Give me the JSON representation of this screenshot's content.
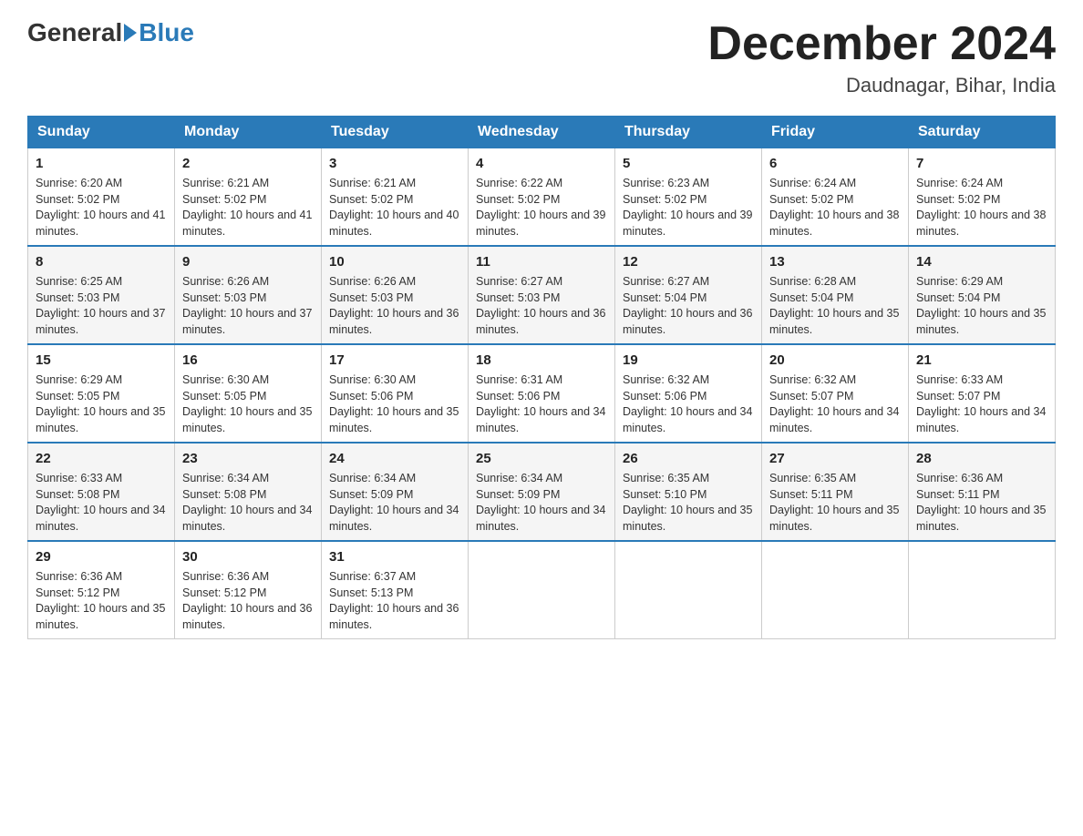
{
  "header": {
    "logo_general": "General",
    "logo_blue": "Blue",
    "title": "December 2024",
    "location": "Daudnagar, Bihar, India"
  },
  "weekdays": [
    "Sunday",
    "Monday",
    "Tuesday",
    "Wednesday",
    "Thursday",
    "Friday",
    "Saturday"
  ],
  "weeks": [
    [
      {
        "day": 1,
        "sunrise": "6:20 AM",
        "sunset": "5:02 PM",
        "daylight": "10 hours and 41 minutes."
      },
      {
        "day": 2,
        "sunrise": "6:21 AM",
        "sunset": "5:02 PM",
        "daylight": "10 hours and 41 minutes."
      },
      {
        "day": 3,
        "sunrise": "6:21 AM",
        "sunset": "5:02 PM",
        "daylight": "10 hours and 40 minutes."
      },
      {
        "day": 4,
        "sunrise": "6:22 AM",
        "sunset": "5:02 PM",
        "daylight": "10 hours and 39 minutes."
      },
      {
        "day": 5,
        "sunrise": "6:23 AM",
        "sunset": "5:02 PM",
        "daylight": "10 hours and 39 minutes."
      },
      {
        "day": 6,
        "sunrise": "6:24 AM",
        "sunset": "5:02 PM",
        "daylight": "10 hours and 38 minutes."
      },
      {
        "day": 7,
        "sunrise": "6:24 AM",
        "sunset": "5:02 PM",
        "daylight": "10 hours and 38 minutes."
      }
    ],
    [
      {
        "day": 8,
        "sunrise": "6:25 AM",
        "sunset": "5:03 PM",
        "daylight": "10 hours and 37 minutes."
      },
      {
        "day": 9,
        "sunrise": "6:26 AM",
        "sunset": "5:03 PM",
        "daylight": "10 hours and 37 minutes."
      },
      {
        "day": 10,
        "sunrise": "6:26 AM",
        "sunset": "5:03 PM",
        "daylight": "10 hours and 36 minutes."
      },
      {
        "day": 11,
        "sunrise": "6:27 AM",
        "sunset": "5:03 PM",
        "daylight": "10 hours and 36 minutes."
      },
      {
        "day": 12,
        "sunrise": "6:27 AM",
        "sunset": "5:04 PM",
        "daylight": "10 hours and 36 minutes."
      },
      {
        "day": 13,
        "sunrise": "6:28 AM",
        "sunset": "5:04 PM",
        "daylight": "10 hours and 35 minutes."
      },
      {
        "day": 14,
        "sunrise": "6:29 AM",
        "sunset": "5:04 PM",
        "daylight": "10 hours and 35 minutes."
      }
    ],
    [
      {
        "day": 15,
        "sunrise": "6:29 AM",
        "sunset": "5:05 PM",
        "daylight": "10 hours and 35 minutes."
      },
      {
        "day": 16,
        "sunrise": "6:30 AM",
        "sunset": "5:05 PM",
        "daylight": "10 hours and 35 minutes."
      },
      {
        "day": 17,
        "sunrise": "6:30 AM",
        "sunset": "5:06 PM",
        "daylight": "10 hours and 35 minutes."
      },
      {
        "day": 18,
        "sunrise": "6:31 AM",
        "sunset": "5:06 PM",
        "daylight": "10 hours and 34 minutes."
      },
      {
        "day": 19,
        "sunrise": "6:32 AM",
        "sunset": "5:06 PM",
        "daylight": "10 hours and 34 minutes."
      },
      {
        "day": 20,
        "sunrise": "6:32 AM",
        "sunset": "5:07 PM",
        "daylight": "10 hours and 34 minutes."
      },
      {
        "day": 21,
        "sunrise": "6:33 AM",
        "sunset": "5:07 PM",
        "daylight": "10 hours and 34 minutes."
      }
    ],
    [
      {
        "day": 22,
        "sunrise": "6:33 AM",
        "sunset": "5:08 PM",
        "daylight": "10 hours and 34 minutes."
      },
      {
        "day": 23,
        "sunrise": "6:34 AM",
        "sunset": "5:08 PM",
        "daylight": "10 hours and 34 minutes."
      },
      {
        "day": 24,
        "sunrise": "6:34 AM",
        "sunset": "5:09 PM",
        "daylight": "10 hours and 34 minutes."
      },
      {
        "day": 25,
        "sunrise": "6:34 AM",
        "sunset": "5:09 PM",
        "daylight": "10 hours and 34 minutes."
      },
      {
        "day": 26,
        "sunrise": "6:35 AM",
        "sunset": "5:10 PM",
        "daylight": "10 hours and 35 minutes."
      },
      {
        "day": 27,
        "sunrise": "6:35 AM",
        "sunset": "5:11 PM",
        "daylight": "10 hours and 35 minutes."
      },
      {
        "day": 28,
        "sunrise": "6:36 AM",
        "sunset": "5:11 PM",
        "daylight": "10 hours and 35 minutes."
      }
    ],
    [
      {
        "day": 29,
        "sunrise": "6:36 AM",
        "sunset": "5:12 PM",
        "daylight": "10 hours and 35 minutes."
      },
      {
        "day": 30,
        "sunrise": "6:36 AM",
        "sunset": "5:12 PM",
        "daylight": "10 hours and 36 minutes."
      },
      {
        "day": 31,
        "sunrise": "6:37 AM",
        "sunset": "5:13 PM",
        "daylight": "10 hours and 36 minutes."
      },
      null,
      null,
      null,
      null
    ]
  ],
  "labels": {
    "sunrise": "Sunrise:",
    "sunset": "Sunset:",
    "daylight": "Daylight:"
  }
}
